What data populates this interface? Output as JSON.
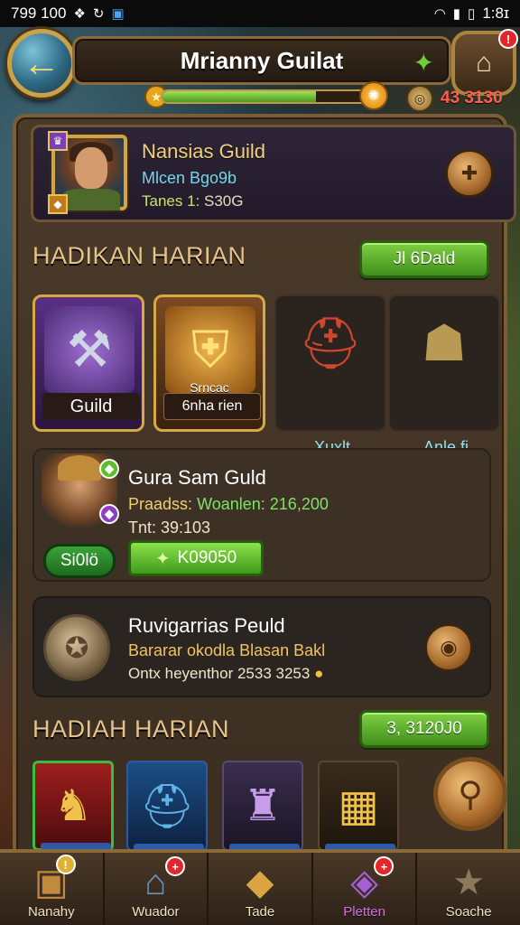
{
  "status_bar": {
    "time": "799 100",
    "right_text": "1:8ɪ"
  },
  "header": {
    "title": "Mrianny Guilat",
    "currency_value": "43 3130",
    "xp_progress": 0.72
  },
  "guild_card": {
    "name": "Nansias Guild",
    "line2": "Mlcen Bgo9b",
    "line3_key": "Tanes 1:",
    "line3_value": "S30G"
  },
  "section1": {
    "title": "HADIKAN HARIAN",
    "button_label": "Jl 6Dald"
  },
  "rewards": [
    {
      "label": "Guild"
    },
    {
      "label": "6nha rien",
      "overlay": "Srncac"
    },
    {
      "label": "Xuxlt"
    },
    {
      "label": "Anle fi"
    }
  ],
  "quest": {
    "title": "Gura Sam Guld",
    "line2_key": "Praadss:",
    "line2_value": "Woanlen: 216,200",
    "line3": "Tnt: 39:103",
    "btn_left": "Si0lö",
    "btn_right": "K09050"
  },
  "event": {
    "title": "Ruvigarrias Peuld",
    "line2": "Bararar okodla Blasan Bakl",
    "line3": "Ontx heyenthor 2533 3253"
  },
  "section2": {
    "title": "HADIAH HARIAN",
    "button_label": "3, 3120J0"
  },
  "bottom_nav": [
    {
      "label": "Nanahy"
    },
    {
      "label": "Wuador"
    },
    {
      "label": "Tade"
    },
    {
      "label": "Pletten"
    },
    {
      "label": "Soache"
    }
  ],
  "colors": {
    "accent_green": "#5fb52a",
    "gold": "#d7a943",
    "currency_red": "#ff5f4f",
    "active_purple": "#d76fe6"
  }
}
